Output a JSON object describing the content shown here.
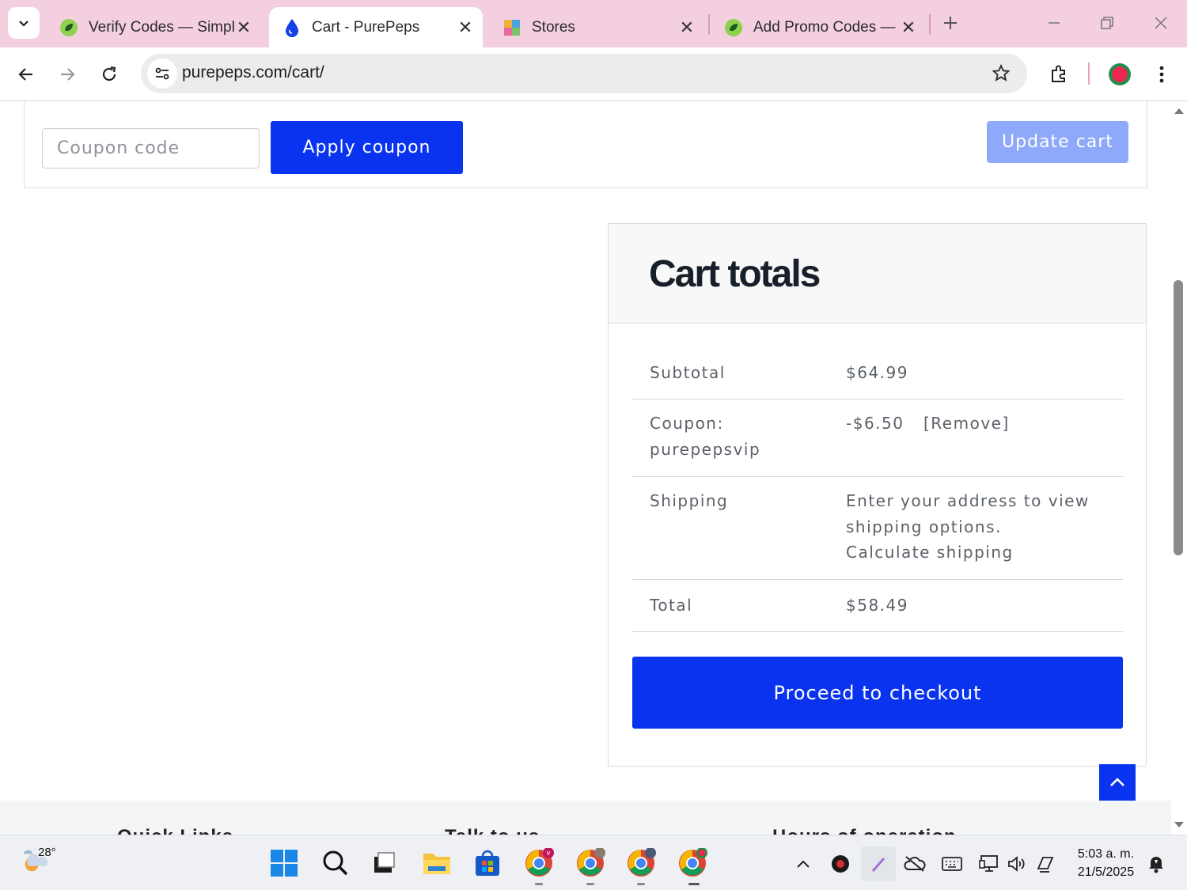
{
  "browser": {
    "tabs": [
      {
        "title": "Verify Codes — Simply",
        "active": false,
        "icon": "leaf-icon"
      },
      {
        "title": "Cart - PurePeps",
        "active": true,
        "icon": "droplet-icon"
      },
      {
        "title": "Stores",
        "active": false,
        "icon": "stores-icon"
      },
      {
        "title": "Add Promo Codes — S",
        "active": false,
        "icon": "leaf-icon"
      }
    ],
    "url": "purepeps.com/cart/"
  },
  "cart": {
    "coupon_placeholder": "Coupon code",
    "apply_label": "Apply coupon",
    "update_label": "Update cart"
  },
  "totals": {
    "title": "Cart totals",
    "rows": {
      "subtotal": {
        "label": "Subtotal",
        "value": "$64.99"
      },
      "coupon": {
        "label_line1": "Coupon:",
        "label_line2": "purepepsvip",
        "value": "-$6.50",
        "remove": "[Remove]"
      },
      "shipping": {
        "label": "Shipping",
        "value_line1": "Enter your address to view",
        "value_line2": "shipping options.",
        "link": "Calculate shipping"
      },
      "total": {
        "label": "Total",
        "value": "$58.49"
      }
    },
    "checkout_label": "Proceed to checkout"
  },
  "footer": {
    "headings": [
      "Quick Links",
      "Talk to us",
      "Hours of operation"
    ]
  },
  "taskbar": {
    "temperature": "28°",
    "time": "5:03 a. m.",
    "date": "21/5/2025"
  },
  "colors": {
    "accent_blue": "#0a33f0",
    "update_blue": "#8ea8fa",
    "tabbar_pink": "#f3cfe0"
  }
}
